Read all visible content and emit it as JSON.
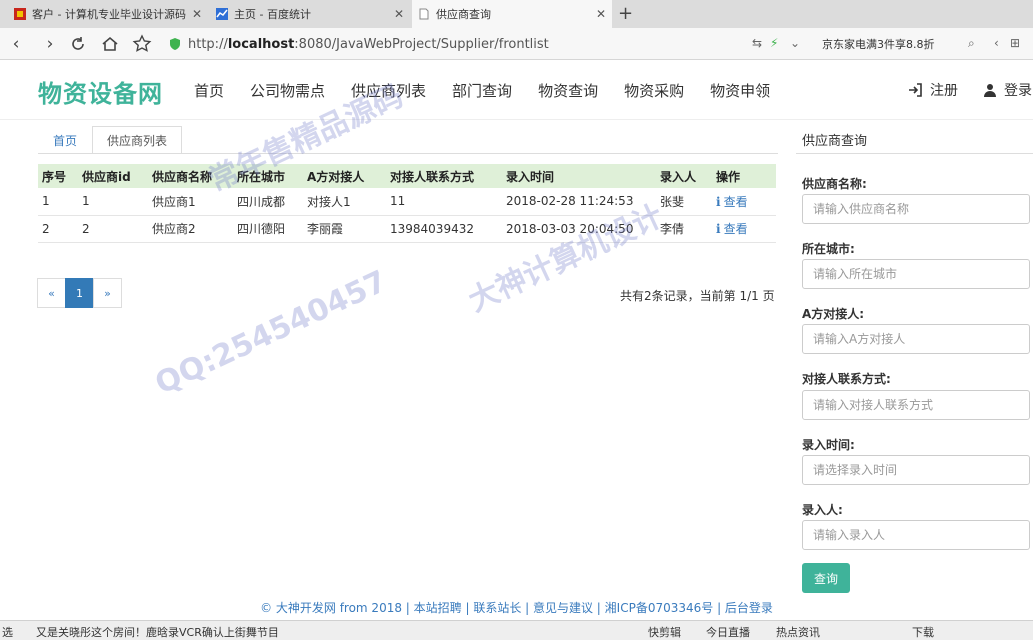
{
  "browser": {
    "tabs": [
      {
        "title": "客户 - 计算机专业毕业设计源码",
        "icon": "red-flag-icon",
        "active": false
      },
      {
        "title": "主页 - 百度统计",
        "icon": "chart-icon",
        "active": false
      },
      {
        "title": "供应商查询",
        "icon": "page-icon",
        "active": true
      }
    ],
    "new_tab": "+",
    "url_prefix": "http://",
    "url_host": "localhost",
    "url_path": ":8080/JavaWebProject/Supplier/frontlist",
    "promo": "京东家电满3件享8.8折"
  },
  "site": {
    "logo": "物资设备网",
    "nav": [
      "首页",
      "公司物需点",
      "供应商列表",
      "部门查询",
      "物资查询",
      "物资采购",
      "物资申领"
    ],
    "register": "注册",
    "login": "登录"
  },
  "breadcrumb_tabs": [
    "首页",
    "供应商列表"
  ],
  "table": {
    "headers": [
      "序号",
      "供应商id",
      "供应商名称",
      "所在城市",
      "A方对接人",
      "对接人联系方式",
      "录入时间",
      "录入人",
      "操作"
    ],
    "rows": [
      {
        "seq": "1",
        "id": "1",
        "name": "供应商1",
        "city": "四川成都",
        "contact": "对接人1",
        "phone": "11",
        "time": "2018-02-28 11:24:53",
        "recorder": "张斐",
        "action": "查看"
      },
      {
        "seq": "2",
        "id": "2",
        "name": "供应商2",
        "city": "四川德阳",
        "contact": "李丽霞",
        "phone": "13984039432",
        "time": "2018-03-03 20:04:50",
        "recorder": "李倩",
        "action": "查看"
      }
    ]
  },
  "pager": {
    "prev": "«",
    "current": "1",
    "next": "»",
    "info": "共有2条记录，当前第 1/1 页"
  },
  "sidebar": {
    "title": "供应商查询",
    "fields": [
      {
        "label": "供应商名称:",
        "placeholder": "请输入供应商名称"
      },
      {
        "label": "所在城市:",
        "placeholder": "请输入所在城市"
      },
      {
        "label": "A方对接人:",
        "placeholder": "请输入A方对接人"
      },
      {
        "label": "对接人联系方式:",
        "placeholder": "请输入对接人联系方式"
      },
      {
        "label": "录入时间:",
        "placeholder": "请选择录入时间"
      },
      {
        "label": "录入人:",
        "placeholder": "请输入录入人"
      }
    ],
    "query_button": "查询"
  },
  "footer": "© 大神开发网 from 2018 | 本站招聘 | 联系站长 | 意见与建议 | 湘ICP备0703346号 | 后台登录",
  "statusbar": {
    "left_cut": "选",
    "news": "又是关晓彤这个房间！鹿晗录VCR确认上街舞节目",
    "items": [
      "快剪辑",
      "今日直播",
      "热点资讯",
      "下载"
    ]
  },
  "watermarks": [
    "QQ:254540457",
    "大神计算机设计",
    "常年售精品源码"
  ],
  "colors": {
    "brand": "#3fb39a",
    "link": "#3a7bbd",
    "table_header": "#dff0d8",
    "page_active": "#337ab7"
  }
}
